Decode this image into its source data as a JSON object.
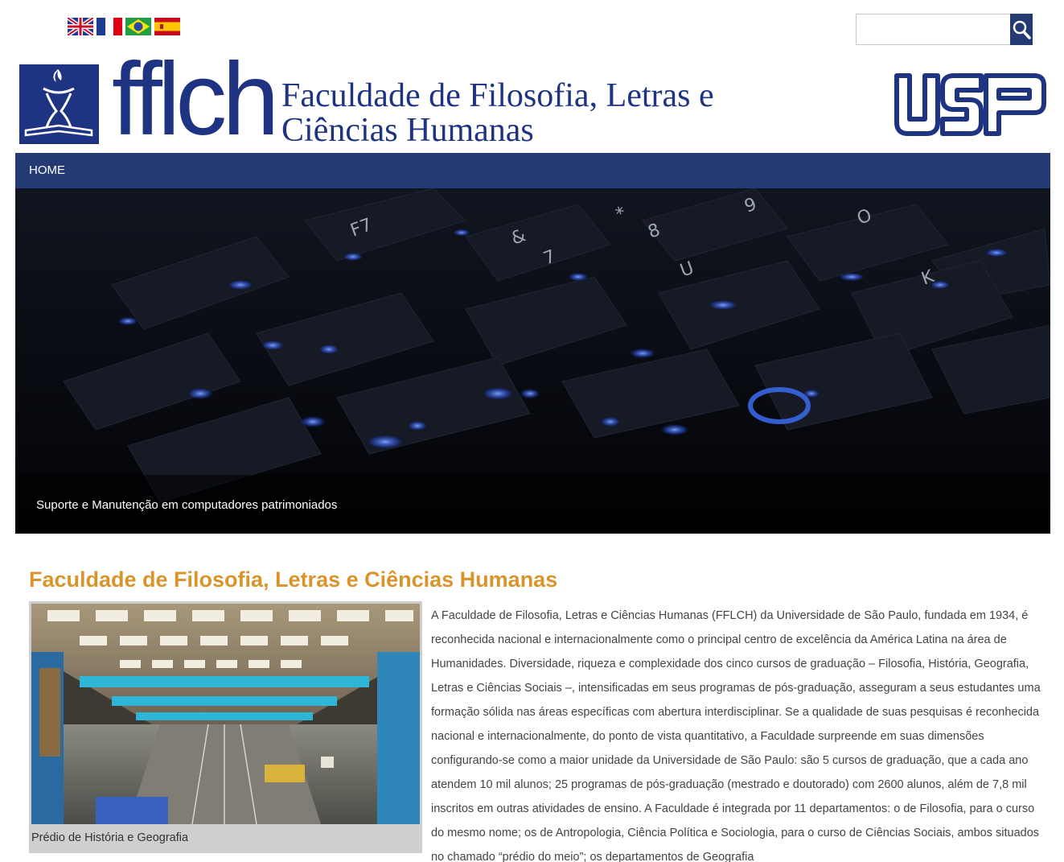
{
  "languages": [
    {
      "name": "english-flag-icon"
    },
    {
      "name": "french-flag-icon"
    },
    {
      "name": "brazil-flag-icon"
    },
    {
      "name": "spanish-flag-icon"
    }
  ],
  "search": {
    "placeholder": "",
    "value": "",
    "icon": "search-icon"
  },
  "header": {
    "logo_text": "fflch",
    "title": "Faculdade de Filosofia, Letras e Ciências Humanas",
    "university_logo": "USP"
  },
  "nav": {
    "items": [
      {
        "label": "HOME"
      }
    ]
  },
  "hero": {
    "caption": "Suporte e Manutenção em computadores patrimoniados"
  },
  "main": {
    "title": "Faculdade de Filosofia, Letras e Ciências Humanas",
    "figure_caption": "Prédio de História e Geografia",
    "body": "A Faculdade de Filosofia, Letras e Ciências Humanas (FFLCH) da Universidade de São Paulo, fundada em 1934, é reconhecida nacional e internacionalmente como o principal centro de excelência da América Latina na área de Humanidades. Diversidade, riqueza e complexidade dos cinco cursos de graduação – Filosofia, História, Geografia, Letras e Ciências Sociais –, intensificadas em seus programas de pós-graduação, asseguram a seus estudantes uma formação sólida nas áreas específicas com abertura interdisciplinar. Se a qualidade de suas pesquisas é reconhecida nacional e internacionalmente, do ponto de vista quantitativo, a Faculdade surpreende em suas dimensões configurando-se como a maior unidade da Universidade de São Paulo: são 5 cursos de graduação, que a cada ano atendem 10 mil alunos; 25 programas de pós-graduação (mestrado e doutorado) com 2600 alunos, além de 7,8 mil inscritos em outras atividades de ensino. A Faculdade é integrada por 11 departamentos: o de Filosofia, para o curso do mesmo nome; os de Antropologia, Ciência Política e Sociologia, para o curso de Ciências Sociais, ambos situados no chamado “prédio do meio”; os departamentos de Geografia"
  },
  "colors": {
    "brand": "#1e3382",
    "nav": "#233a73",
    "accent": "#d9952c"
  }
}
